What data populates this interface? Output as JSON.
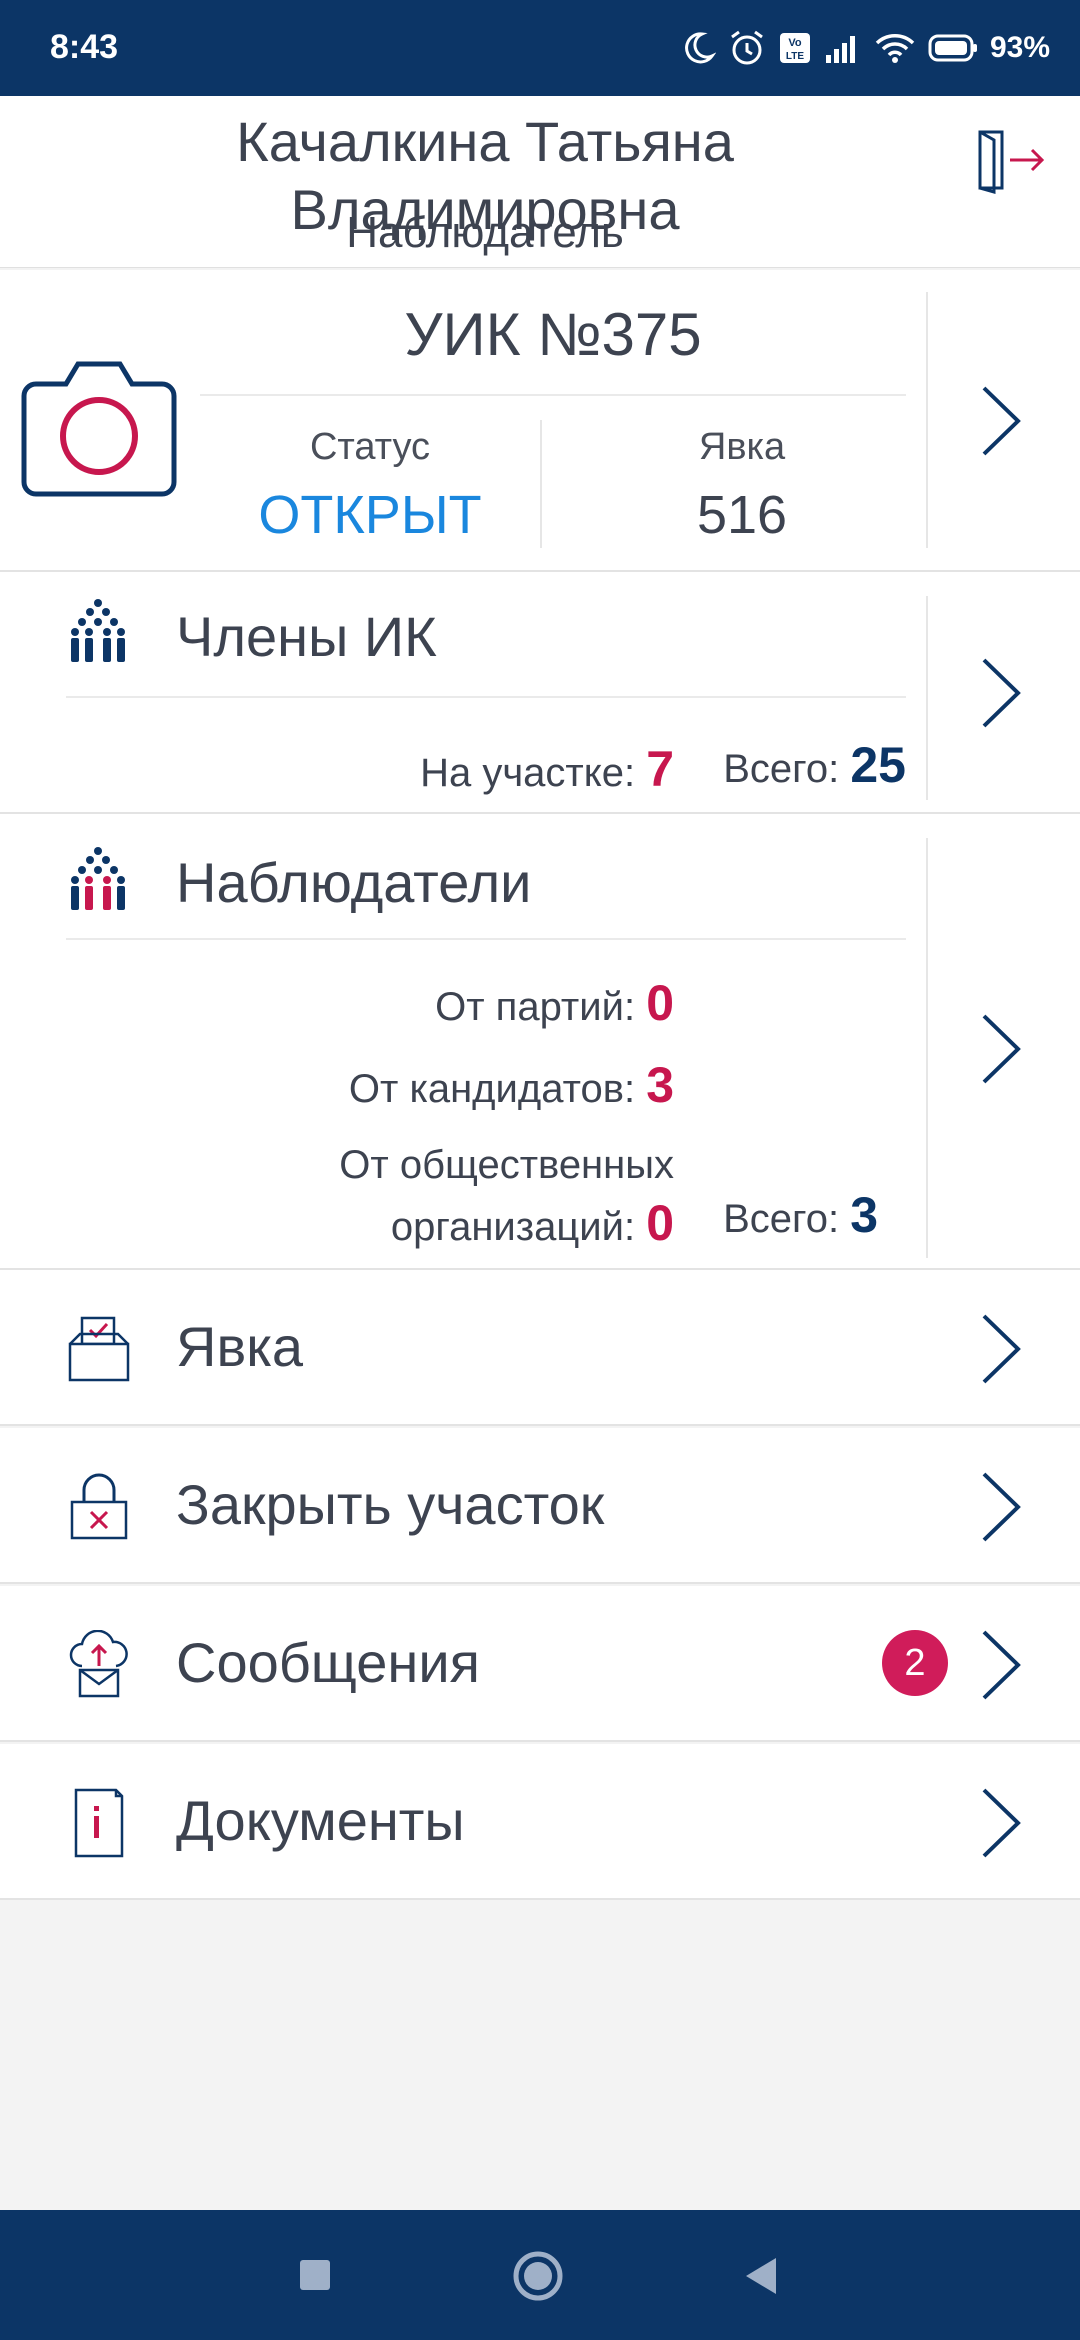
{
  "status_bar": {
    "time": "8:43",
    "battery": "93%",
    "icons": [
      "moon-icon",
      "alarm-icon",
      "volte-icon",
      "signal-icon",
      "wifi-icon",
      "battery-icon"
    ]
  },
  "header": {
    "name_line1": "Качалкина Татьяна",
    "name_line2": "Владимировна",
    "role": "Наблюдатель"
  },
  "uik": {
    "title": "УИК №375",
    "status_label": "Статус",
    "status_value": "ОТКРЫТ",
    "turnout_label": "Явка",
    "turnout_value": "516"
  },
  "members": {
    "title": "Члены ИК",
    "on_site_label": "На участке:",
    "on_site_value": "7",
    "total_label": "Всего:",
    "total_value": "25"
  },
  "observers": {
    "title": "Наблюдатели",
    "parties_label": "От партий:",
    "parties_value": "0",
    "candidates_label": "От кандидатов:",
    "candidates_value": "3",
    "orgs_label_line1": "От общественных",
    "orgs_label_line2": "организаций:",
    "orgs_value": "0",
    "total_label": "Всего:",
    "total_value": "3"
  },
  "menu": {
    "turnout": "Явка",
    "close_precinct": "Закрыть участок",
    "messages": "Сообщения",
    "messages_badge": "2",
    "documents": "Документы"
  },
  "colors": {
    "primary_navy": "#0c3566",
    "accent_pink": "#c7174e",
    "status_blue": "#1a87de"
  }
}
